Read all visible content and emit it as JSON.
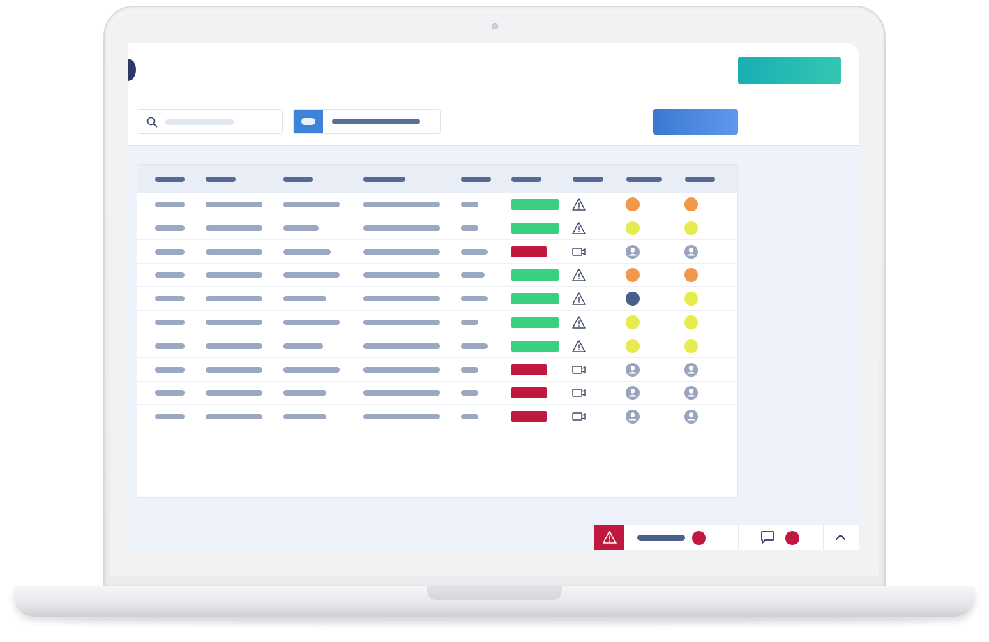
{
  "colors": {
    "teal_button": "#19aeb2",
    "blue_button": "#3a78d1",
    "logo": "#2b3a67",
    "status_ok": "#3ad07f",
    "status_bad": "#c0183f",
    "header_bar": "#566b94",
    "cell_bar": "#9aa8c2"
  },
  "icons": {
    "search": "search-icon",
    "warning": "warning-icon",
    "camera": "video-camera-icon",
    "user": "user-avatar-icon",
    "chat": "chat-icon",
    "chevron_up": "chevron-up-icon",
    "alert": "alert-icon"
  },
  "table": {
    "column_count": 9,
    "rows": [
      {
        "status": "ok",
        "type_icon": "warning",
        "ind1": "orange",
        "ind2": "orange"
      },
      {
        "status": "ok",
        "type_icon": "warning",
        "ind1": "yellow",
        "ind2": "yellow"
      },
      {
        "status": "bad",
        "type_icon": "camera",
        "ind1": "user",
        "ind2": "user"
      },
      {
        "status": "ok",
        "type_icon": "warning",
        "ind1": "orange",
        "ind2": "orange"
      },
      {
        "status": "ok",
        "type_icon": "warning",
        "ind1": "navy",
        "ind2": "yellow"
      },
      {
        "status": "ok",
        "type_icon": "warning",
        "ind1": "yellow",
        "ind2": "yellow"
      },
      {
        "status": "ok",
        "type_icon": "warning",
        "ind1": "yellow",
        "ind2": "yellow"
      },
      {
        "status": "bad",
        "type_icon": "camera",
        "ind1": "user",
        "ind2": "user"
      },
      {
        "status": "bad",
        "type_icon": "camera",
        "ind1": "user",
        "ind2": "user"
      },
      {
        "status": "bad",
        "type_icon": "camera",
        "ind1": "user",
        "ind2": "user"
      }
    ]
  },
  "indicator_colors": {
    "orange": "#f0994a",
    "yellow": "#e6ec4d",
    "navy": "#4a5e8c",
    "user": "#9aa5bd"
  }
}
